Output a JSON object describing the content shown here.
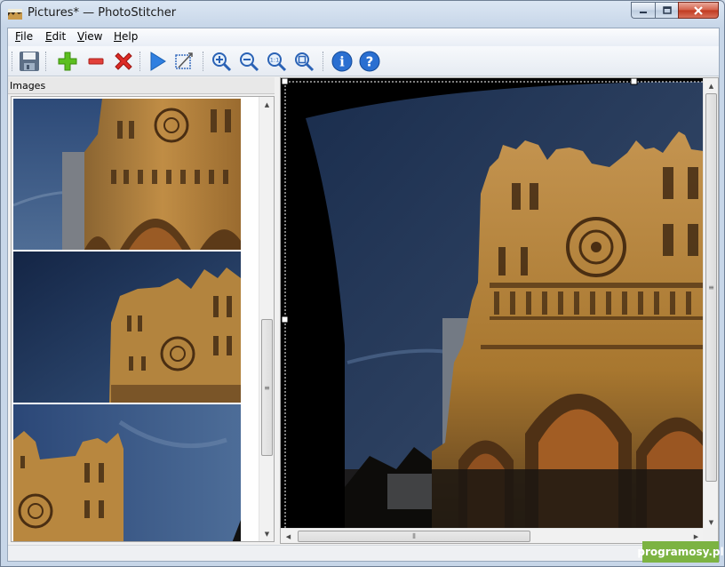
{
  "window": {
    "title": "Pictures* — PhotoStitcher",
    "app_icon": "landscape-photo-icon"
  },
  "menu": {
    "items": [
      {
        "label": "File",
        "accel": "F",
        "rest": "ile"
      },
      {
        "label": "Edit",
        "accel": "E",
        "rest": "dit"
      },
      {
        "label": "View",
        "accel": "V",
        "rest": "iew"
      },
      {
        "label": "Help",
        "accel": "H",
        "rest": "elp"
      }
    ]
  },
  "toolbar": {
    "buttons": [
      {
        "name": "save",
        "icon": "floppy-disk-icon"
      },
      {
        "name": "add-image",
        "icon": "plus-icon"
      },
      {
        "name": "remove-image",
        "icon": "minus-icon"
      },
      {
        "name": "clear-images",
        "icon": "red-x-icon"
      },
      {
        "name": "stitch",
        "icon": "play-icon"
      },
      {
        "name": "crop",
        "icon": "crop-icon"
      },
      {
        "name": "zoom-in",
        "icon": "zoom-in-icon"
      },
      {
        "name": "zoom-out",
        "icon": "zoom-out-icon"
      },
      {
        "name": "zoom-actual",
        "icon": "zoom-actual-size-icon",
        "label": "1:1"
      },
      {
        "name": "zoom-fit",
        "icon": "zoom-fit-icon"
      },
      {
        "name": "info",
        "icon": "info-icon",
        "label": "i"
      },
      {
        "name": "help",
        "icon": "help-icon",
        "label": "?"
      }
    ]
  },
  "images_panel": {
    "title": "Images",
    "thumbnails": [
      {
        "name": "cathedral-photo-1"
      },
      {
        "name": "cathedral-photo-2"
      },
      {
        "name": "cathedral-photo-3"
      }
    ]
  },
  "preview": {
    "name": "stitched-panorama-cathedral"
  },
  "colors": {
    "sky": "#2e4262",
    "stone": "#a8772f",
    "shadow": "#1a1510"
  },
  "watermark": "programosy.pl"
}
